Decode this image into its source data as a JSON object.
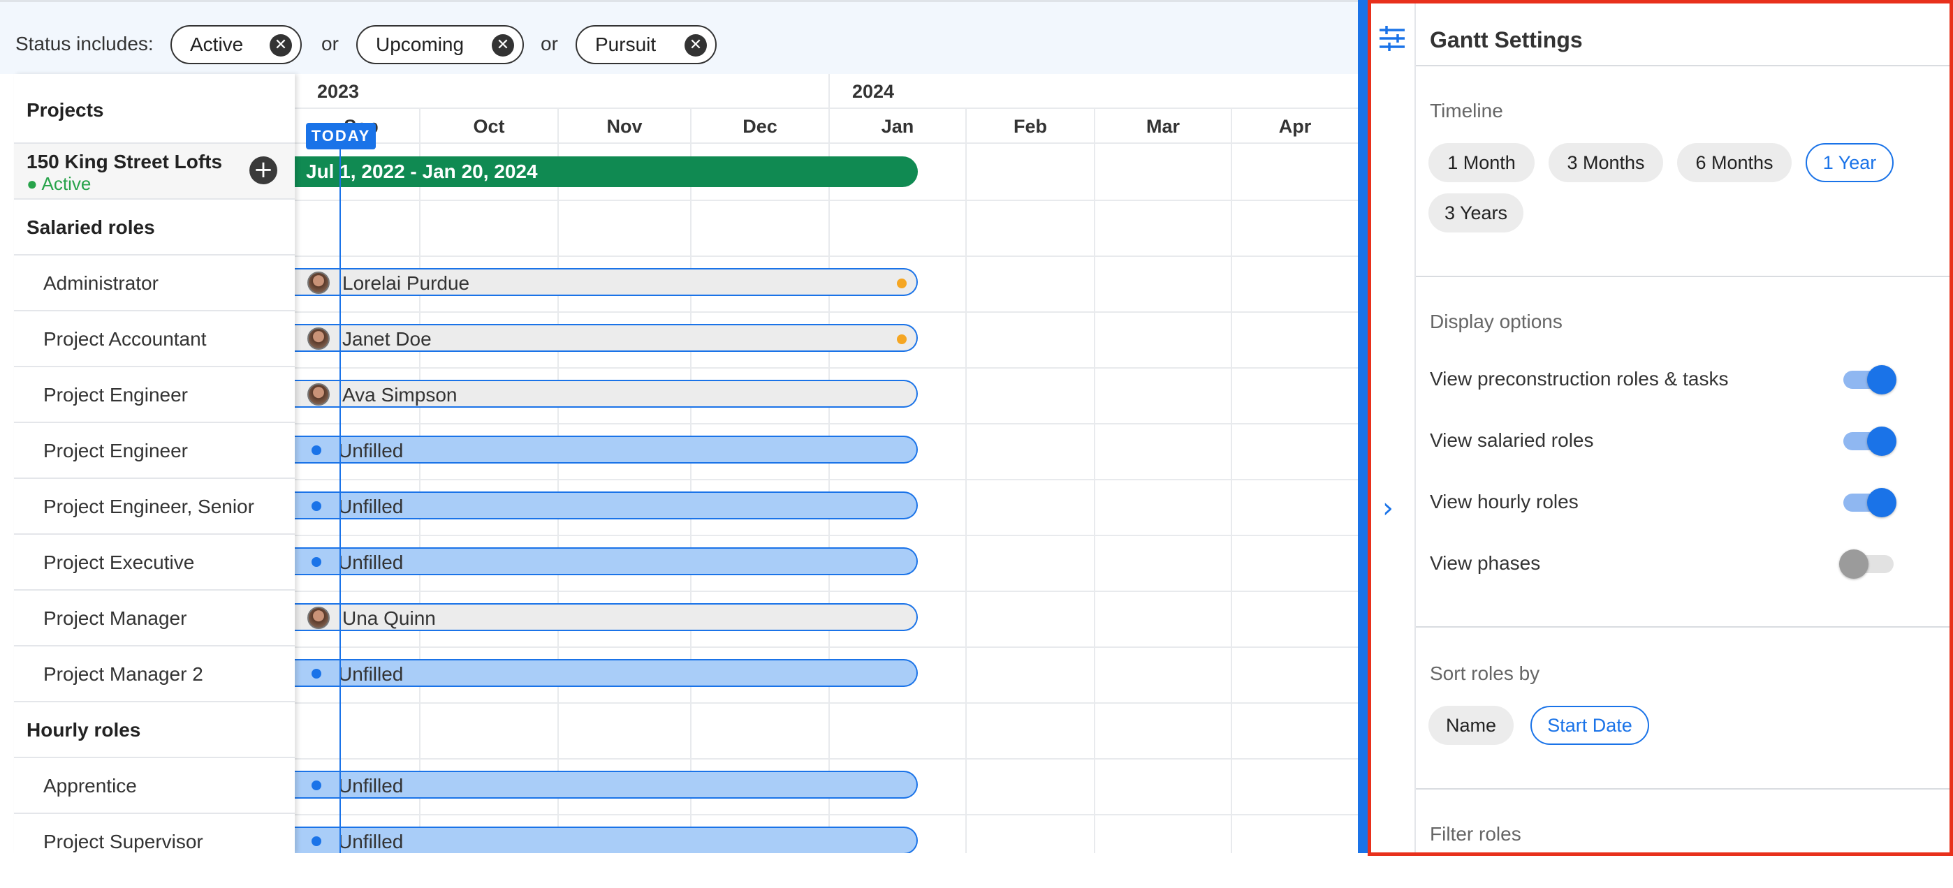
{
  "filter": {
    "label": "Status includes:",
    "chips": [
      "Active",
      "Upcoming",
      "Pursuit"
    ],
    "connector": "or",
    "remove_icon": "close-circle-icon"
  },
  "left": {
    "projects_header": "Projects",
    "project": {
      "name": "150 King Street Lofts",
      "status": "Active",
      "status_color": "#27a34a"
    },
    "salaried_header": "Salaried roles",
    "salaried_roles": [
      "Administrator",
      "Project Accountant",
      "Project Engineer",
      "Project Engineer",
      "Project Engineer, Senior",
      "Project Executive",
      "Project Manager",
      "Project Manager 2"
    ],
    "hourly_header": "Hourly roles",
    "hourly_roles": [
      "Apprentice",
      "Project Supervisor"
    ]
  },
  "timeline": {
    "years": [
      "2023",
      "2024"
    ],
    "months": [
      "Sep",
      "Oct",
      "Nov",
      "Dec",
      "Jan",
      "Feb",
      "Mar",
      "Apr"
    ],
    "today_label": "TODAY",
    "project_bar": "Jul 1, 2022 - Jan 20, 2024",
    "project_bar_color": "#108a52",
    "salaried_bars": [
      {
        "label": "Lorelai Purdue",
        "type": "person",
        "flag": true
      },
      {
        "label": "Janet Doe",
        "type": "person",
        "flag": true
      },
      {
        "label": "Ava Simpson",
        "type": "person",
        "flag": false
      },
      {
        "label": "Unfilled",
        "type": "unfilled",
        "flag": false
      },
      {
        "label": "Unfilled",
        "type": "unfilled",
        "flag": false
      },
      {
        "label": "Unfilled",
        "type": "unfilled",
        "flag": false
      },
      {
        "label": "Una Quinn",
        "type": "person",
        "flag": false
      },
      {
        "label": "Unfilled",
        "type": "unfilled",
        "flag": false
      }
    ],
    "hourly_bars": [
      {
        "label": "Unfilled",
        "type": "unfilled",
        "flag": false
      },
      {
        "label": "Unfilled",
        "type": "unfilled",
        "flag": false
      }
    ],
    "accent": "#1a73e8"
  },
  "panel": {
    "title": "Gantt Settings",
    "rail_icon": "sliders-icon",
    "collapse_icon": "chevron-right-icon",
    "timeline_label": "Timeline",
    "timeline_options": [
      "1 Month",
      "3 Months",
      "6 Months",
      "1 Year",
      "3 Years"
    ],
    "timeline_selected": "1 Year",
    "display_label": "Display options",
    "display_options": [
      {
        "label": "View preconstruction roles & tasks",
        "on": true
      },
      {
        "label": "View salaried roles",
        "on": true
      },
      {
        "label": "View hourly roles",
        "on": true
      },
      {
        "label": "View phases",
        "on": false
      }
    ],
    "sort_label": "Sort roles by",
    "sort_options": [
      "Name",
      "Start Date"
    ],
    "sort_selected": "Start Date",
    "filter_label": "Filter roles",
    "border_color": "#e8301c"
  }
}
